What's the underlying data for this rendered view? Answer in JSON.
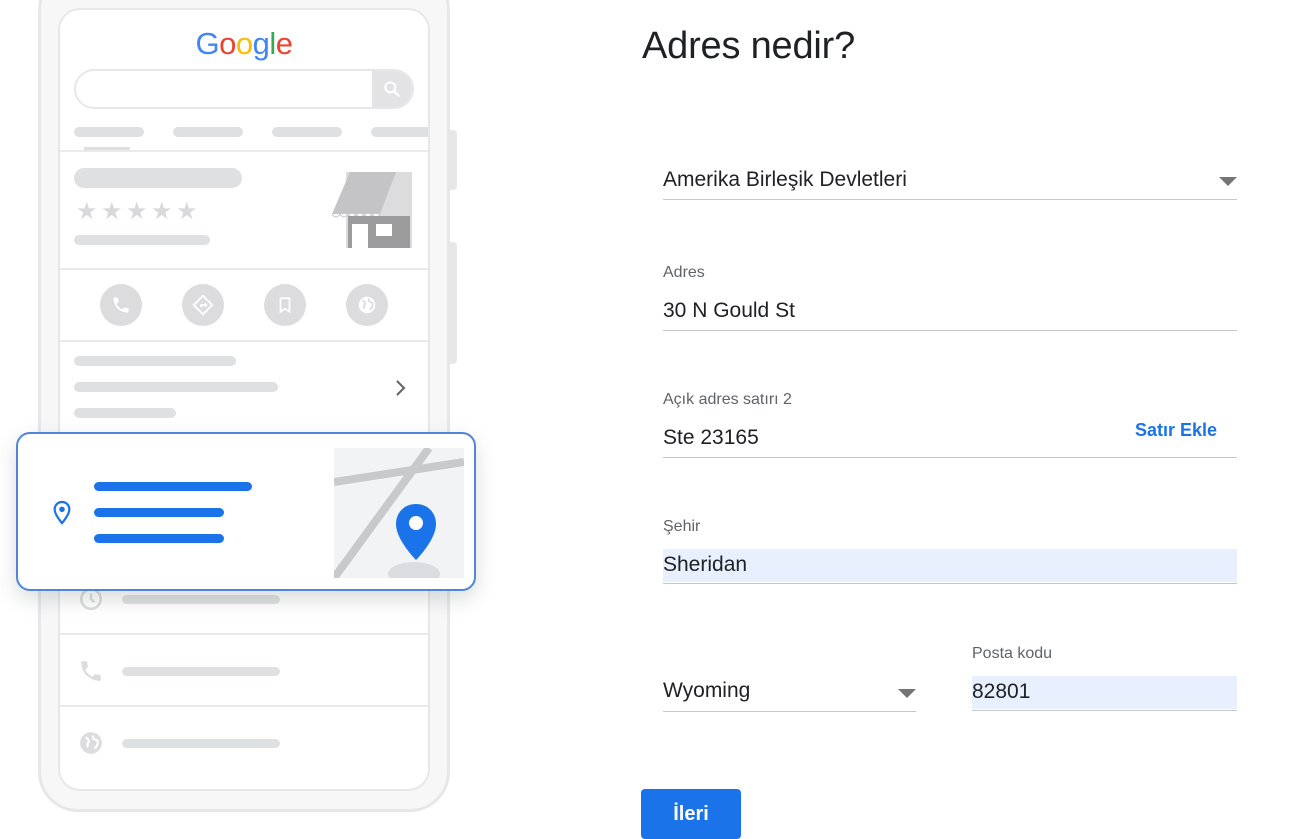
{
  "illustration": {
    "brand": [
      "G",
      "o",
      "o",
      "g",
      "l",
      "e"
    ],
    "brand_colors": [
      "#4285f4",
      "#ea4335",
      "#fbbc05",
      "#4285f4",
      "#34a853",
      "#ea4335"
    ],
    "accent_color": "#1a73e8",
    "placeholder_color": "#dfe0e2",
    "rating_stars": 5,
    "icons": [
      "search-icon",
      "phone-icon",
      "directions-icon",
      "bookmark-icon",
      "globe-icon",
      "chevron-right-icon",
      "location-pin-icon",
      "map-pin-icon",
      "clock-icon"
    ]
  },
  "form": {
    "heading": "Adres nedir?",
    "country": {
      "value": "Amerika Birleşik Devletleri"
    },
    "address": {
      "label": "Adres",
      "value": "30 N Gould St"
    },
    "address2": {
      "label": "Açık adres satırı 2",
      "value": "Ste 23165",
      "add_line_label": "Satır Ekle"
    },
    "city": {
      "label": "Şehir",
      "value": "Sheridan"
    },
    "state": {
      "value": "Wyoming"
    },
    "postal": {
      "label": "Posta kodu",
      "value": "82801"
    },
    "next_label": "İleri",
    "autofill_color": "#e8f0fe",
    "button_color": "#1a73e8"
  }
}
